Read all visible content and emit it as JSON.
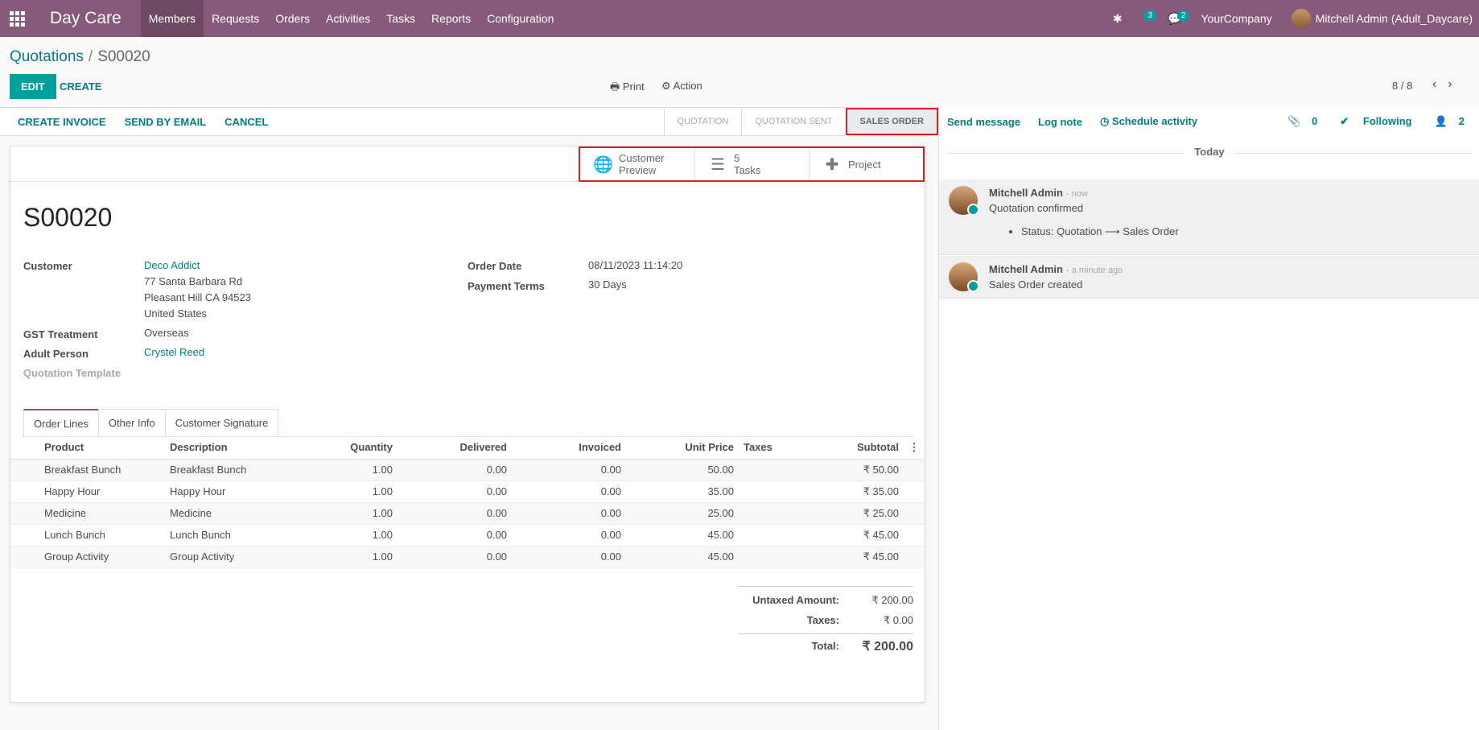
{
  "navbar": {
    "brand": "Day Care",
    "menu": [
      "Members",
      "Requests",
      "Orders",
      "Activities",
      "Tasks",
      "Reports",
      "Configuration"
    ],
    "activity_count": "3",
    "message_count": "2",
    "company": "YourCompany",
    "user": "Mitchell Admin (Adult_Daycare)"
  },
  "control": {
    "breadcrumb_parent": "Quotations",
    "breadcrumb_separator": "/",
    "breadcrumb_current": "S00020",
    "edit_label": "EDIT",
    "create_label": "CREATE",
    "print_label": "Print",
    "action_label": "Action",
    "pager": "8 / 8"
  },
  "statusbar": {
    "buttons": [
      "CREATE INVOICE",
      "SEND BY EMAIL",
      "CANCEL"
    ],
    "stages": [
      "QUOTATION",
      "QUOTATION SENT",
      "SALES ORDER"
    ],
    "current_stage": "SALES ORDER"
  },
  "smart_buttons": {
    "preview_line1": "Customer",
    "preview_line2": "Preview",
    "tasks_count": "5",
    "tasks_label": "Tasks",
    "project_label": "Project"
  },
  "form": {
    "title": "S00020",
    "customer_label": "Customer",
    "customer_name": "Deco Addict",
    "address1": "77 Santa Barbara Rd",
    "address2": "Pleasant Hill CA 94523",
    "address3": "United States",
    "gst_label": "GST Treatment",
    "gst_value": "Overseas",
    "adult_label": "Adult Person",
    "adult_value": "Crystel Reed",
    "template_label": "Quotation Template",
    "order_date_label": "Order Date",
    "order_date_value": "08/11/2023 11:14:20",
    "payment_label": "Payment Terms",
    "payment_value": "30 Days"
  },
  "tabs": [
    "Order Lines",
    "Other Info",
    "Customer Signature"
  ],
  "order_lines": {
    "headers": {
      "product": "Product",
      "description": "Description",
      "quantity": "Quantity",
      "delivered": "Delivered",
      "invoiced": "Invoiced",
      "unit_price": "Unit Price",
      "taxes": "Taxes",
      "subtotal": "Subtotal"
    },
    "rows": [
      {
        "product": "Breakfast Bunch",
        "description": "Breakfast Bunch",
        "quantity": "1.00",
        "delivered": "0.00",
        "invoiced": "0.00",
        "unit_price": "50.00",
        "taxes": "",
        "subtotal": "₹ 50.00"
      },
      {
        "product": "Happy Hour",
        "description": "Happy Hour",
        "quantity": "1.00",
        "delivered": "0.00",
        "invoiced": "0.00",
        "unit_price": "35.00",
        "taxes": "",
        "subtotal": "₹ 35.00"
      },
      {
        "product": "Medicine",
        "description": "Medicine",
        "quantity": "1.00",
        "delivered": "0.00",
        "invoiced": "0.00",
        "unit_price": "25.00",
        "taxes": "",
        "subtotal": "₹ 25.00"
      },
      {
        "product": "Lunch Bunch",
        "description": "Lunch Bunch",
        "quantity": "1.00",
        "delivered": "0.00",
        "invoiced": "0.00",
        "unit_price": "45.00",
        "taxes": "",
        "subtotal": "₹ 45.00"
      },
      {
        "product": "Group Activity",
        "description": "Group Activity",
        "quantity": "1.00",
        "delivered": "0.00",
        "invoiced": "0.00",
        "unit_price": "45.00",
        "taxes": "",
        "subtotal": "₹ 45.00"
      }
    ]
  },
  "totals": {
    "untaxed_label": "Untaxed Amount:",
    "untaxed_value": "₹ 200.00",
    "taxes_label": "Taxes:",
    "taxes_value": "₹ 0.00",
    "total_label": "Total:",
    "total_value": "₹ 200.00"
  },
  "chatter": {
    "send_message": "Send message",
    "log_note": "Log note",
    "schedule_activity": "Schedule activity",
    "attachments": "0",
    "following": "Following",
    "followers": "2",
    "today": "Today",
    "messages": [
      {
        "author": "Mitchell Admin",
        "time": "- now",
        "body": "Quotation confirmed",
        "tracking": "Status: Quotation ⟶ Sales Order"
      },
      {
        "author": "Mitchell Admin",
        "time": "- a minute ago",
        "body": "Sales Order created"
      }
    ]
  },
  "colors": {
    "navbar": "#875a7b",
    "primary": "#00a09d",
    "link": "#017e84",
    "highlight": "#e02020"
  }
}
